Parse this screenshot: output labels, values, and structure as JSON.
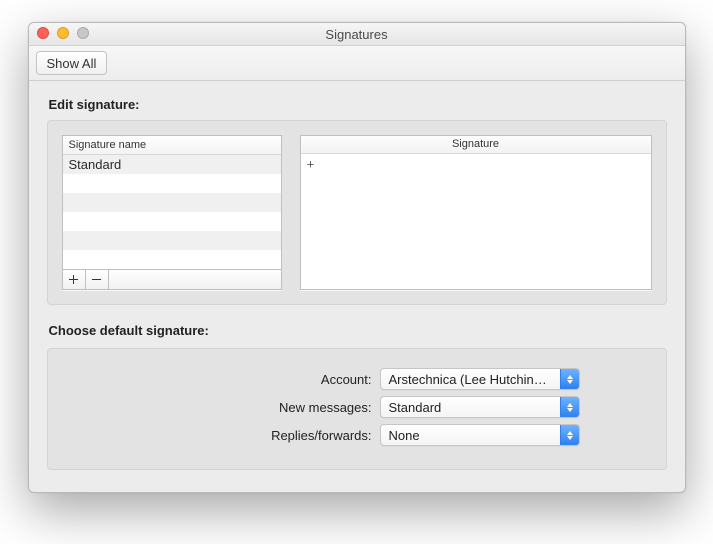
{
  "window": {
    "title": "Signatures"
  },
  "toolbar": {
    "show_all_label": "Show All"
  },
  "edit": {
    "section_label": "Edit signature:",
    "list_header": "Signature name",
    "items": [
      "Standard"
    ],
    "editor_header": "Signature",
    "editor_content": "+"
  },
  "defaults": {
    "section_label": "Choose default signature:",
    "account_label": "Account:",
    "account_value": "Arstechnica (Lee Hutchinson)",
    "new_messages_label": "New messages:",
    "new_messages_value": "Standard",
    "replies_label": "Replies/forwards:",
    "replies_value": "None"
  }
}
